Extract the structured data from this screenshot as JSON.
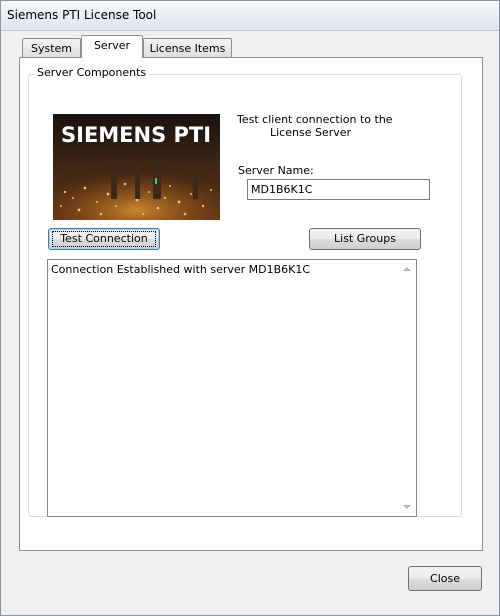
{
  "window": {
    "title": "Siemens PTI License Tool"
  },
  "tabs": [
    {
      "label": "System",
      "active": false
    },
    {
      "label": "Server",
      "active": true
    },
    {
      "label": "License Items",
      "active": false
    }
  ],
  "server_panel": {
    "group_label": "Server Components",
    "logo_text": "SIEMENS PTI",
    "description_line1": "Test client connection to the",
    "description_line2": "License Server",
    "server_name_label": "Server Name:",
    "server_name_value": "MD1B6K1C",
    "test_connection_label": "Test Connection",
    "list_groups_label": "List Groups",
    "output_text": "Connection Established with server MD1B6K1C"
  },
  "footer": {
    "close_label": "Close"
  },
  "colors": {
    "title_bar": "#dde5ef",
    "default_button_border": "#3c7fb1",
    "logo_background": "#2a1b10"
  }
}
